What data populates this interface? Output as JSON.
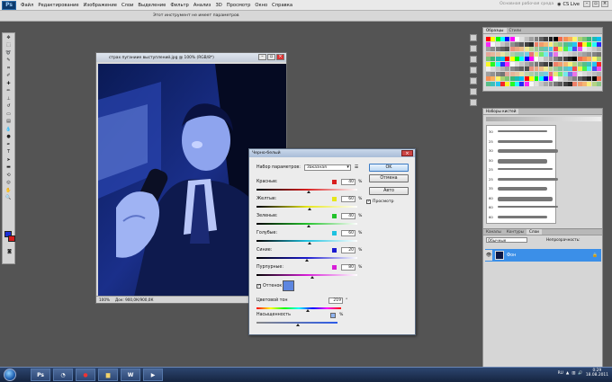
{
  "app": {
    "logo": "Ps",
    "menu": [
      "Файл",
      "Редактирование",
      "Изображение",
      "Слои",
      "Выделение",
      "Фильтр",
      "Анализ",
      "3D",
      "Просмотр",
      "Окно",
      "Справка"
    ],
    "workspace_label": "Основная рабочая среда",
    "cslive": "CS Live"
  },
  "options_bar": {
    "text": "Этот инструмент не имеет параметров"
  },
  "document": {
    "title": "страх пуганиие выступлений.jpg @ 100% (RGB/8*)",
    "zoom": "100%",
    "status": "Док: 900,0К/900,0К"
  },
  "dialog": {
    "title": "Черно-белый",
    "preset_label": "Набор параметров:",
    "preset_value": "Заказная",
    "ok": "OK",
    "cancel": "Отмена",
    "auto": "Авто",
    "preview": "Просмотр",
    "sliders": [
      {
        "label": "Красные:",
        "value": "40",
        "pct": "%",
        "chip": "#d81e1e",
        "level": 0.52
      },
      {
        "label": "Желтые:",
        "value": "60",
        "pct": "%",
        "chip": "#e6e61a",
        "level": 0.53
      },
      {
        "label": "Зеленые:",
        "value": "40",
        "pct": "%",
        "chip": "#22c22a",
        "level": 0.52
      },
      {
        "label": "Голубые:",
        "value": "60",
        "pct": "%",
        "chip": "#1ec2e0",
        "level": 0.53
      },
      {
        "label": "Синие:",
        "value": "20",
        "pct": "%",
        "chip": "#1a1ad0",
        "level": 0.5
      },
      {
        "label": "Пурпурные:",
        "value": "80",
        "pct": "%",
        "chip": "#d81ed8",
        "level": 0.55
      }
    ],
    "tint_label": "Оттенок",
    "tint_color": "#5d86e0",
    "hue_label": "Цветовой тон",
    "hue_value": "219",
    "hue_unit": "°",
    "saturation_label": "Насыщенность",
    "saturation_unit": "%"
  },
  "panels": {
    "swatches_tabs": [
      "Образцы",
      "Стили"
    ],
    "brushes_tab": "Наборы кистей",
    "brush_sizes": [
      "30",
      "25",
      "30",
      "50",
      "25",
      "25",
      "35",
      "60",
      "60",
      "60"
    ],
    "layers_tabs": [
      "Каналы",
      "Контуры",
      "Слои"
    ],
    "blend_mode": "Обычные",
    "opacity_label": "Непрозрачность:",
    "layer_name": "Фон"
  },
  "taskbar": {
    "lang": "RU",
    "time": "0:29",
    "date": "18.08.2011",
    "buttons": [
      "Ps",
      "",
      "",
      "",
      "W",
      ""
    ]
  }
}
